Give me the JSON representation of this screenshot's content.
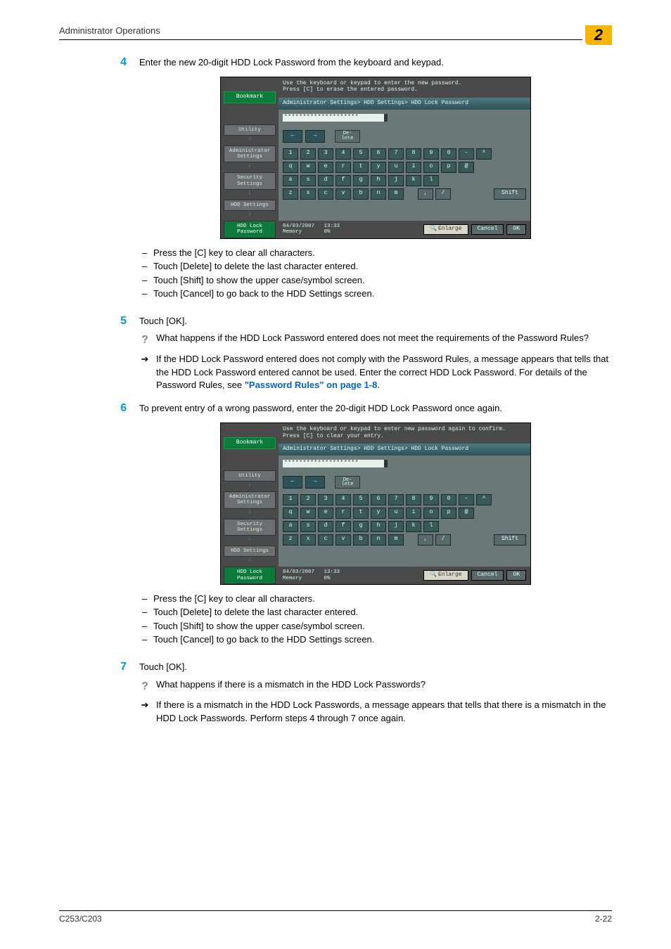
{
  "header": {
    "title": "Administrator Operations",
    "chapter": "2"
  },
  "footer": {
    "left": "C253/C203",
    "right": "2-22"
  },
  "steps": {
    "s4": {
      "num": "4",
      "text": "Enter the new 20-digit HDD Lock Password from the keyboard and keypad.",
      "bullets": [
        "Press the [C] key to clear all characters.",
        "Touch [Delete] to delete the last character entered.",
        "Touch [Shift] to show the upper case/symbol screen.",
        "Touch [Cancel] to go back to the HDD Settings screen."
      ]
    },
    "s5": {
      "num": "5",
      "text": "Touch [OK].",
      "q": "What happens if the HDD Lock Password entered does not meet the requirements of the Password Rules?",
      "a_pre": "If the HDD Lock Password entered does not comply with the Password Rules, a message appears that tells that the HDD Lock Password entered cannot be used. Enter the correct HDD Lock Password. For details of the Password Rules, see ",
      "a_link": "\"Password Rules\" on page 1-8",
      "a_post": "."
    },
    "s6": {
      "num": "6",
      "text": "To prevent entry of a wrong password, enter the 20-digit HDD Lock Password once again.",
      "bullets": [
        "Press the [C] key to clear all characters.",
        "Touch [Delete] to delete the last character entered.",
        "Touch [Shift] to show the upper case/symbol screen.",
        "Touch [Cancel] to go back to the HDD Settings screen."
      ]
    },
    "s7": {
      "num": "7",
      "text": "Touch [OK].",
      "q": "What happens if there is a mismatch in the HDD Lock Passwords?",
      "a": "If there is a mismatch in the HDD Lock Passwords, a message appears that tells that there is a mismatch in the HDD Lock Passwords. Perform steps 4 through 7 once again."
    }
  },
  "panel": {
    "instr1": "Use the keyboard or keypad to enter the new password.\nPress [C] to erase the entered password.",
    "instr2": "Use the keyboard or keypad to enter new password again to confirm.\nPress [C] to clear your entry.",
    "breadcrumb": "Administrator Settings> HDD Settings> HDD Lock Password",
    "password_mask": "********************",
    "bookmark": "Bookmark",
    "side": [
      "Utility",
      "Administrator Settings",
      "Security Settings",
      "HDD Settings",
      "HDD Lock Password"
    ],
    "delete": "De-\nlete",
    "shift": "Shift",
    "row1": [
      "1",
      "2",
      "3",
      "4",
      "5",
      "6",
      "7",
      "8",
      "9",
      "0",
      "-",
      "^"
    ],
    "row2": [
      "q",
      "w",
      "e",
      "r",
      "t",
      "y",
      "u",
      "i",
      "o",
      "p",
      "@"
    ],
    "row3": [
      "a",
      "s",
      "d",
      "f",
      "g",
      "h",
      "j",
      "k",
      "l"
    ],
    "row4": [
      "z",
      "x",
      "c",
      "v",
      "b",
      "n",
      "m"
    ],
    "sym": [
      ",",
      "/"
    ],
    "status_date": "04/03/2007",
    "status_time": "13:33",
    "status_mem": "Memory",
    "status_pct": "0%",
    "enlarge": "Enlarge",
    "cancel": "Cancel",
    "ok": "OK"
  }
}
